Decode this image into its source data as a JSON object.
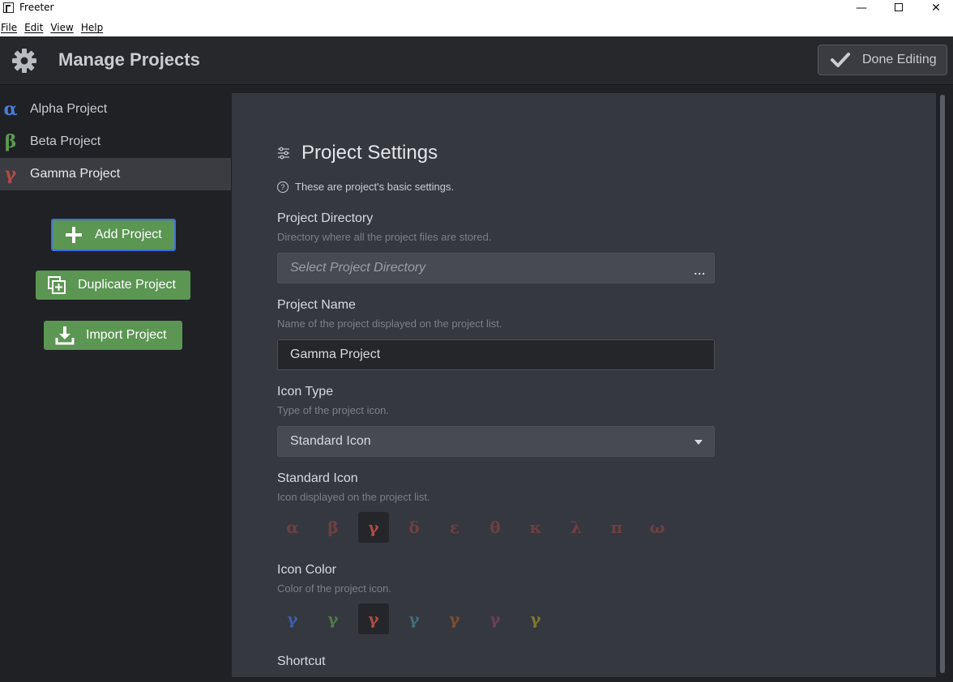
{
  "window": {
    "title": "Freeter"
  },
  "menu": [
    {
      "label": "File"
    },
    {
      "label": "Edit"
    },
    {
      "label": "View"
    },
    {
      "label": "Help"
    }
  ],
  "header": {
    "title": "Manage Projects",
    "done_label": "Done Editing"
  },
  "projects": [
    {
      "glyph": "α",
      "name": "Alpha Project",
      "color": "#4a7bd6",
      "selected": false
    },
    {
      "glyph": "β",
      "name": "Beta Project",
      "color": "#5b9a53",
      "selected": false
    },
    {
      "glyph": "γ",
      "name": "Gamma Project",
      "color": "#b04a45",
      "selected": true
    }
  ],
  "sidebar_buttons": {
    "add": "Add Project",
    "duplicate": "Duplicate Project",
    "import": "Import Project"
  },
  "settings": {
    "title": "Project Settings",
    "intro": "These are project's basic settings.",
    "directory": {
      "label": "Project Directory",
      "desc": "Directory where all the project files are stored.",
      "placeholder": "Select Project Directory",
      "browse": "..."
    },
    "name": {
      "label": "Project Name",
      "desc": "Name of the project displayed on the project list.",
      "value": "Gamma Project"
    },
    "icon_type": {
      "label": "Icon Type",
      "desc": "Type of the project icon.",
      "value": "Standard Icon"
    },
    "standard_icon": {
      "label": "Standard Icon",
      "desc": "Icon displayed on the project list.",
      "options": [
        "α",
        "β",
        "γ",
        "δ",
        "ε",
        "θ",
        "κ",
        "λ",
        "π",
        "ω"
      ],
      "selected_index": 2
    },
    "icon_color": {
      "label": "Icon Color",
      "desc": "Color of the project icon.",
      "glyph": "γ",
      "options": [
        "#3b5ea8",
        "#4d7a47",
        "#b04a45",
        "#3f6f78",
        "#7a5033",
        "#6b3f5c",
        "#7a7a2e"
      ],
      "selected_index": 2
    },
    "shortcut": {
      "label": "Shortcut"
    }
  }
}
